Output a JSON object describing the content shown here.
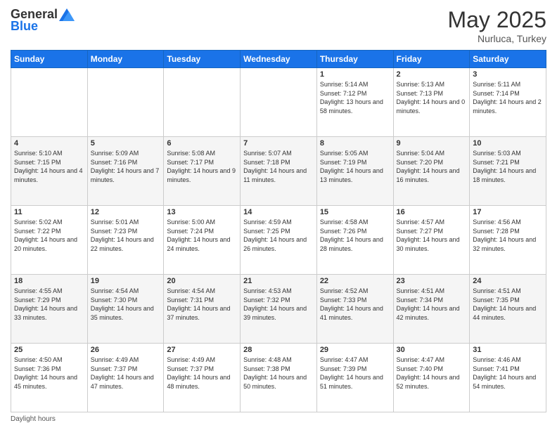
{
  "header": {
    "logo_general": "General",
    "logo_blue": "Blue",
    "title": "May 2025",
    "location": "Nurluca, Turkey"
  },
  "footer": {
    "note": "Daylight hours"
  },
  "days_of_week": [
    "Sunday",
    "Monday",
    "Tuesday",
    "Wednesday",
    "Thursday",
    "Friday",
    "Saturday"
  ],
  "weeks": [
    [
      {
        "day": "",
        "info": ""
      },
      {
        "day": "",
        "info": ""
      },
      {
        "day": "",
        "info": ""
      },
      {
        "day": "",
        "info": ""
      },
      {
        "day": "1",
        "info": "Sunrise: 5:14 AM\nSunset: 7:12 PM\nDaylight: 13 hours\nand 58 minutes."
      },
      {
        "day": "2",
        "info": "Sunrise: 5:13 AM\nSunset: 7:13 PM\nDaylight: 14 hours\nand 0 minutes."
      },
      {
        "day": "3",
        "info": "Sunrise: 5:11 AM\nSunset: 7:14 PM\nDaylight: 14 hours\nand 2 minutes."
      }
    ],
    [
      {
        "day": "4",
        "info": "Sunrise: 5:10 AM\nSunset: 7:15 PM\nDaylight: 14 hours\nand 4 minutes."
      },
      {
        "day": "5",
        "info": "Sunrise: 5:09 AM\nSunset: 7:16 PM\nDaylight: 14 hours\nand 7 minutes."
      },
      {
        "day": "6",
        "info": "Sunrise: 5:08 AM\nSunset: 7:17 PM\nDaylight: 14 hours\nand 9 minutes."
      },
      {
        "day": "7",
        "info": "Sunrise: 5:07 AM\nSunset: 7:18 PM\nDaylight: 14 hours\nand 11 minutes."
      },
      {
        "day": "8",
        "info": "Sunrise: 5:05 AM\nSunset: 7:19 PM\nDaylight: 14 hours\nand 13 minutes."
      },
      {
        "day": "9",
        "info": "Sunrise: 5:04 AM\nSunset: 7:20 PM\nDaylight: 14 hours\nand 16 minutes."
      },
      {
        "day": "10",
        "info": "Sunrise: 5:03 AM\nSunset: 7:21 PM\nDaylight: 14 hours\nand 18 minutes."
      }
    ],
    [
      {
        "day": "11",
        "info": "Sunrise: 5:02 AM\nSunset: 7:22 PM\nDaylight: 14 hours\nand 20 minutes."
      },
      {
        "day": "12",
        "info": "Sunrise: 5:01 AM\nSunset: 7:23 PM\nDaylight: 14 hours\nand 22 minutes."
      },
      {
        "day": "13",
        "info": "Sunrise: 5:00 AM\nSunset: 7:24 PM\nDaylight: 14 hours\nand 24 minutes."
      },
      {
        "day": "14",
        "info": "Sunrise: 4:59 AM\nSunset: 7:25 PM\nDaylight: 14 hours\nand 26 minutes."
      },
      {
        "day": "15",
        "info": "Sunrise: 4:58 AM\nSunset: 7:26 PM\nDaylight: 14 hours\nand 28 minutes."
      },
      {
        "day": "16",
        "info": "Sunrise: 4:57 AM\nSunset: 7:27 PM\nDaylight: 14 hours\nand 30 minutes."
      },
      {
        "day": "17",
        "info": "Sunrise: 4:56 AM\nSunset: 7:28 PM\nDaylight: 14 hours\nand 32 minutes."
      }
    ],
    [
      {
        "day": "18",
        "info": "Sunrise: 4:55 AM\nSunset: 7:29 PM\nDaylight: 14 hours\nand 33 minutes."
      },
      {
        "day": "19",
        "info": "Sunrise: 4:54 AM\nSunset: 7:30 PM\nDaylight: 14 hours\nand 35 minutes."
      },
      {
        "day": "20",
        "info": "Sunrise: 4:54 AM\nSunset: 7:31 PM\nDaylight: 14 hours\nand 37 minutes."
      },
      {
        "day": "21",
        "info": "Sunrise: 4:53 AM\nSunset: 7:32 PM\nDaylight: 14 hours\nand 39 minutes."
      },
      {
        "day": "22",
        "info": "Sunrise: 4:52 AM\nSunset: 7:33 PM\nDaylight: 14 hours\nand 41 minutes."
      },
      {
        "day": "23",
        "info": "Sunrise: 4:51 AM\nSunset: 7:34 PM\nDaylight: 14 hours\nand 42 minutes."
      },
      {
        "day": "24",
        "info": "Sunrise: 4:51 AM\nSunset: 7:35 PM\nDaylight: 14 hours\nand 44 minutes."
      }
    ],
    [
      {
        "day": "25",
        "info": "Sunrise: 4:50 AM\nSunset: 7:36 PM\nDaylight: 14 hours\nand 45 minutes."
      },
      {
        "day": "26",
        "info": "Sunrise: 4:49 AM\nSunset: 7:37 PM\nDaylight: 14 hours\nand 47 minutes."
      },
      {
        "day": "27",
        "info": "Sunrise: 4:49 AM\nSunset: 7:37 PM\nDaylight: 14 hours\nand 48 minutes."
      },
      {
        "day": "28",
        "info": "Sunrise: 4:48 AM\nSunset: 7:38 PM\nDaylight: 14 hours\nand 50 minutes."
      },
      {
        "day": "29",
        "info": "Sunrise: 4:47 AM\nSunset: 7:39 PM\nDaylight: 14 hours\nand 51 minutes."
      },
      {
        "day": "30",
        "info": "Sunrise: 4:47 AM\nSunset: 7:40 PM\nDaylight: 14 hours\nand 52 minutes."
      },
      {
        "day": "31",
        "info": "Sunrise: 4:46 AM\nSunset: 7:41 PM\nDaylight: 14 hours\nand 54 minutes."
      }
    ]
  ]
}
